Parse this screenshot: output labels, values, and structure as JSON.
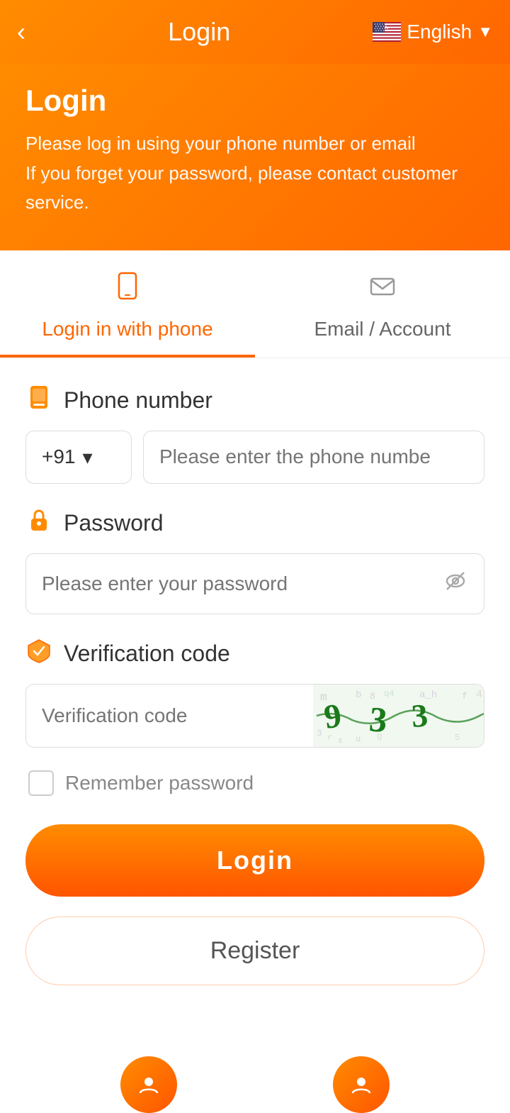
{
  "header": {
    "back_label": "‹",
    "title": "Login",
    "language": "English"
  },
  "banner": {
    "title": "Login",
    "line1": "Please log in using your phone number or email",
    "line2": "If you forget your password, please contact customer service."
  },
  "tabs": [
    {
      "id": "phone",
      "label": "Login in with phone",
      "active": true
    },
    {
      "id": "email",
      "label": "Email / Account",
      "active": false
    }
  ],
  "fields": {
    "phone_label": "Phone number",
    "country_code": "+91",
    "phone_placeholder": "Please enter the phone numbe",
    "password_label": "Password",
    "password_placeholder": "Please enter your password",
    "verification_label": "Verification code",
    "verification_placeholder": "Verification code"
  },
  "remember": {
    "label": "Remember password"
  },
  "buttons": {
    "login": "Login",
    "register": "Register"
  },
  "icons": {
    "phone_tab": "📱",
    "email_tab": "✉",
    "phone_field": "📱",
    "password_field": "🔒",
    "verification_field": "🛡",
    "eye_off": "👁"
  }
}
